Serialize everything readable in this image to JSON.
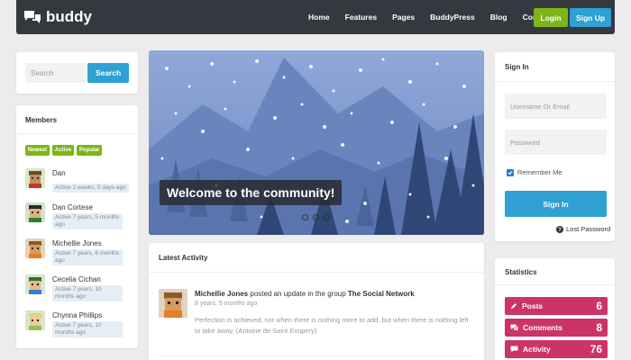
{
  "header": {
    "logo_text": "buddy",
    "nav": [
      "Home",
      "Features",
      "Pages",
      "BuddyPress",
      "Blog",
      "Contact"
    ],
    "login_label": "Login",
    "signup_label": "Sign Up"
  },
  "search": {
    "placeholder": "Search",
    "button_label": "Search"
  },
  "members": {
    "title": "Members",
    "tabs": [
      "Newest",
      "Active",
      "Popular"
    ],
    "list": [
      {
        "name": "Dan",
        "activity": "Active 2 weeks, 5 days ago"
      },
      {
        "name": "Dan Cortese",
        "activity": "Active 7 years, 5 months ago"
      },
      {
        "name": "Michellie Jones",
        "activity": "Active 7 years, 6 months ago"
      },
      {
        "name": "Cecelia Cichan",
        "activity": "Active 7 years, 10 months ago"
      },
      {
        "name": "Chynna Phillips",
        "activity": "Active 7 years, 10 months ago"
      }
    ]
  },
  "hero": {
    "caption": "Welcome to the community!"
  },
  "activity": {
    "title": "Latest Activity",
    "item": {
      "user": "Michellie Jones",
      "action": " posted an update in the group ",
      "group": "The Social Network",
      "time": "8 years, 5 months ago",
      "text": "Perfection is achieved, not when there is nothing more to add, but when there is nothing left to take away. (Antoine de Saint Exupery)"
    }
  },
  "signin": {
    "title": "Sign In",
    "username_placeholder": "Username Or Email",
    "password_placeholder": "Password",
    "remember_label": "Remember Me",
    "button_label": "Sign In",
    "lost_password": "Lost Password"
  },
  "statistics": {
    "title": "Statistics",
    "items": [
      {
        "label": "Posts",
        "value": "6",
        "icon": "pencil-icon"
      },
      {
        "label": "Comments",
        "value": "8",
        "icon": "comments-icon"
      },
      {
        "label": "Activity",
        "value": "76",
        "icon": "chat-icon"
      }
    ]
  },
  "colors": {
    "header_bg": "#35383f",
    "accent_blue": "#2fa0d2",
    "accent_green": "#7cb518",
    "stat_pink": "#cc3366"
  }
}
